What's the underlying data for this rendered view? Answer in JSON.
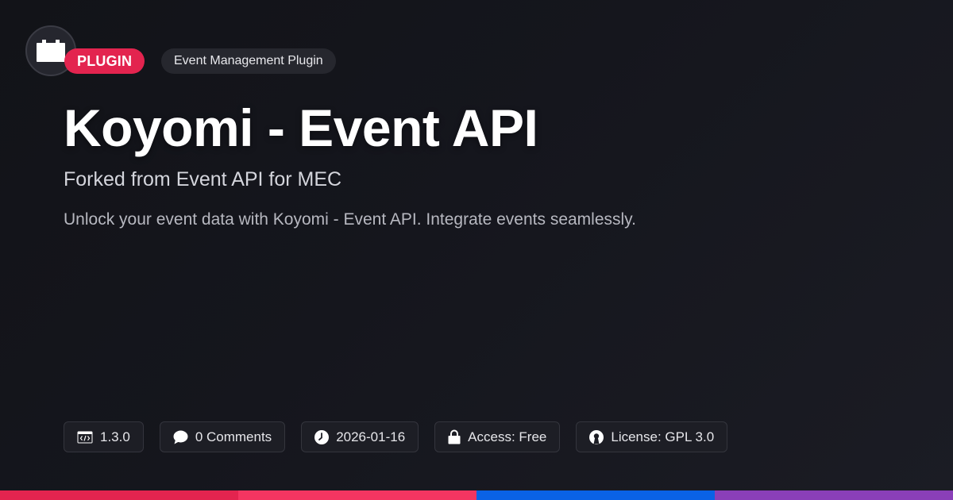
{
  "header": {
    "type_badge": "PLUGIN",
    "category_badge": "Event Management Plugin",
    "logo_icon": "plugin-block-icon"
  },
  "main": {
    "title": "Koyomi - Event API",
    "subtitle": "Forked from Event API for MEC",
    "description": "Unlock your event data with Koyomi - Event API. Integrate events seamlessly."
  },
  "meta": {
    "version": {
      "icon": "code-window-icon",
      "label": "1.3.0"
    },
    "comments": {
      "icon": "speech-bubble-icon",
      "label": "0 Comments"
    },
    "date": {
      "icon": "clock-icon",
      "label": "2026-01-16"
    },
    "access": {
      "icon": "lock-icon",
      "label": "Access: Free"
    },
    "license": {
      "icon": "open-source-icon",
      "label": "License: GPL 3.0"
    }
  },
  "colors": {
    "accent": "#e3244f",
    "bottom_bar": [
      "#e3244f",
      "#f43561",
      "#0a62e6",
      "#8a3fb8"
    ]
  }
}
